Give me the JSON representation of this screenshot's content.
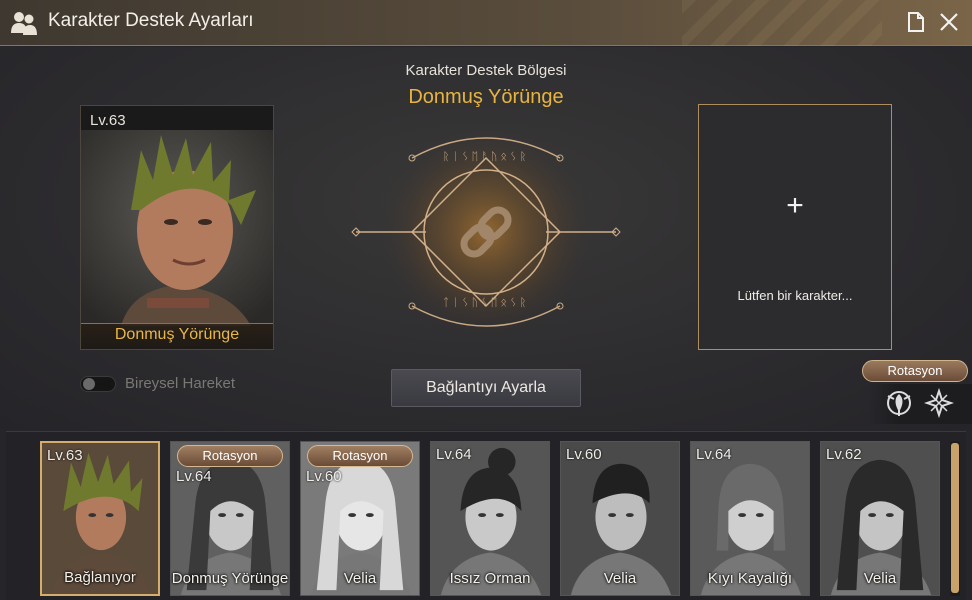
{
  "window": {
    "title": "Karakter Destek Ayarları",
    "icons": {
      "title": "people-icon",
      "memo": "document-icon",
      "close": "close-icon"
    }
  },
  "main": {
    "zone_label": "Karakter Destek Bölgesi",
    "zone_name": "Donmuş Yörünge",
    "selected_character": {
      "level": "Lv.63",
      "name": "Donmuş Yörünge"
    },
    "individual_move": {
      "label": "Bireysel Hareket",
      "enabled": false
    },
    "set_link_button": "Bağlantıyı Ayarla",
    "empty_slot": {
      "plus": "+",
      "hint": "Lütfen bir karakter..."
    },
    "rotation_badge": "Rotasyon"
  },
  "characters": [
    {
      "level": "Lv.63",
      "name": "Bağlanıyor",
      "badge": "",
      "selected": true
    },
    {
      "level": "Lv.64",
      "name": "Donmuş Yörünge",
      "badge": "Rotasyon",
      "selected": false
    },
    {
      "level": "Lv.60",
      "name": "Velia",
      "badge": "Rotasyon",
      "selected": false
    },
    {
      "level": "Lv.64",
      "name": "Issız Orman",
      "badge": "",
      "selected": false
    },
    {
      "level": "Lv.60",
      "name": "Velia",
      "badge": "",
      "selected": false
    },
    {
      "level": "Lv.64",
      "name": "Kıyı Kayalığı",
      "badge": "",
      "selected": false
    },
    {
      "level": "Lv.62",
      "name": "Velia",
      "badge": "",
      "selected": false
    }
  ],
  "colors": {
    "accent": "#e8b43f",
    "border_gold": "#b08d5e"
  }
}
